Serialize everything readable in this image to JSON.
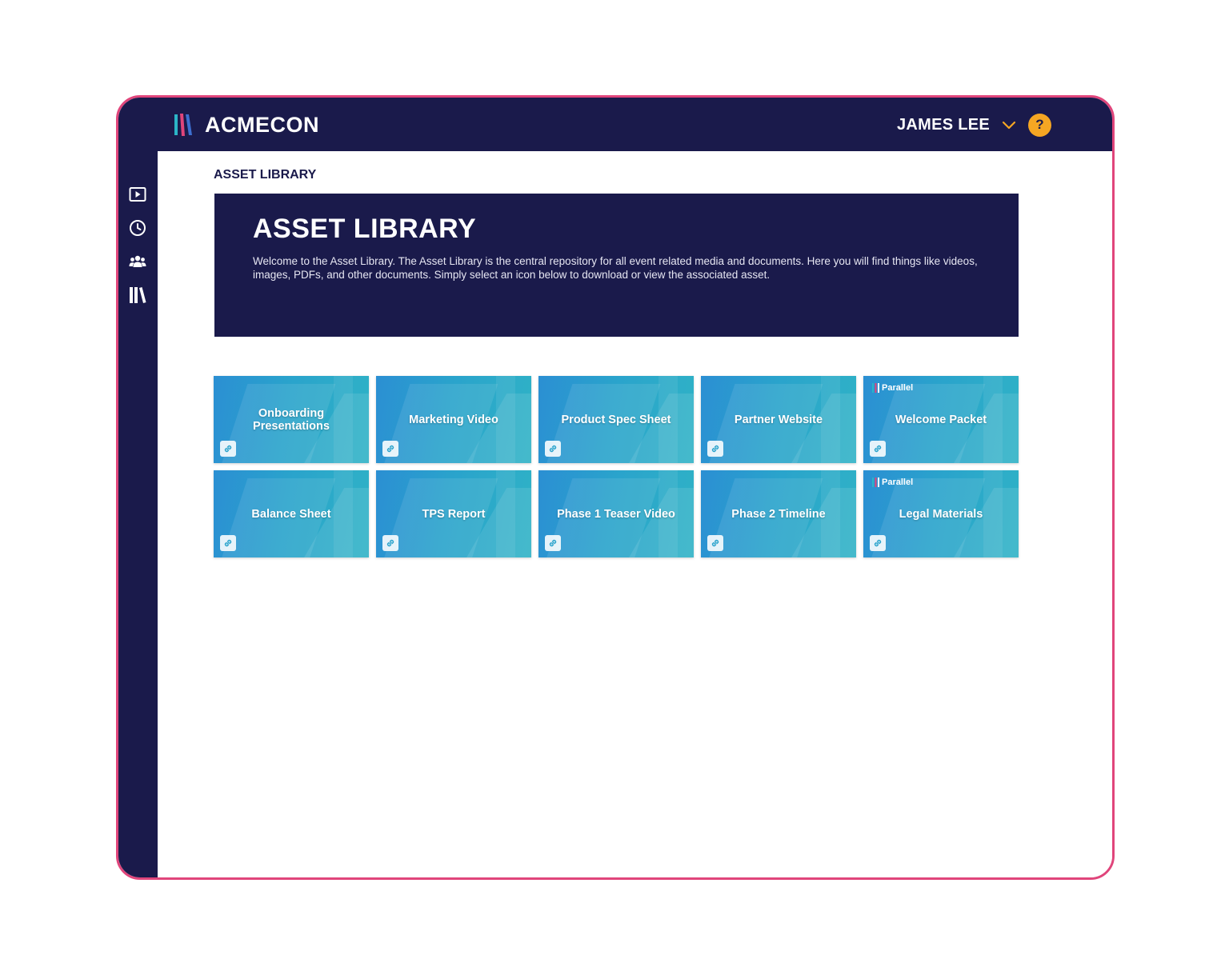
{
  "app": {
    "brand_name": "ACMECON"
  },
  "header": {
    "user_name": "JAMES LEE",
    "help_label": "?"
  },
  "sidebar": {
    "items": [
      {
        "icon": "play-icon"
      },
      {
        "icon": "clock-icon"
      },
      {
        "icon": "people-icon"
      },
      {
        "icon": "library-icon"
      }
    ]
  },
  "page": {
    "title": "ASSET LIBRARY"
  },
  "hero": {
    "title": "ASSET LIBRARY",
    "description": "Welcome to the Asset Library.  The Asset Library is the central repository for all event related media and documents.  Here you will find things like videos, images, PDFs, and other documents.  Simply select an icon below to download or view the associated asset."
  },
  "assets": [
    {
      "title": "Onboarding Presentations",
      "badge": ""
    },
    {
      "title": "Marketing Video",
      "badge": ""
    },
    {
      "title": "Product Spec Sheet",
      "badge": ""
    },
    {
      "title": "Partner Website",
      "badge": ""
    },
    {
      "title": "Welcome Packet",
      "badge": "Parallel"
    },
    {
      "title": "Balance Sheet",
      "badge": ""
    },
    {
      "title": "TPS Report",
      "badge": ""
    },
    {
      "title": "Phase 1 Teaser Video",
      "badge": ""
    },
    {
      "title": "Phase 2 Timeline",
      "badge": ""
    },
    {
      "title": "Legal Materials",
      "badge": "Parallel"
    }
  ],
  "colors": {
    "navy": "#1a1a4b",
    "frame_border": "#e0457b",
    "help_accent": "#f5a623",
    "card_gradient_start": "#2b8fd3",
    "card_gradient_end": "#2fb2c6"
  }
}
